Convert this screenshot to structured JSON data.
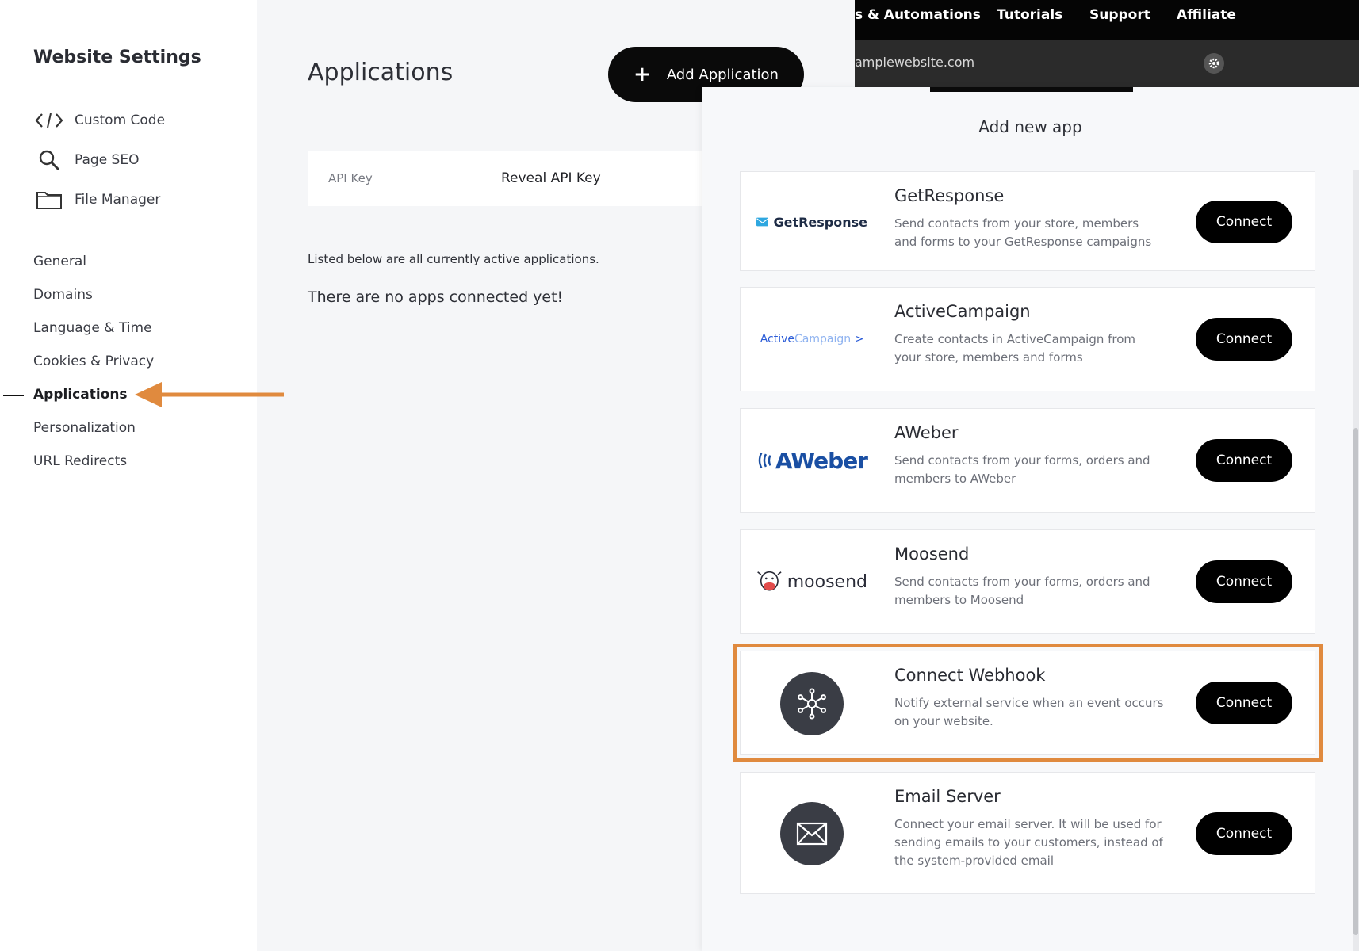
{
  "sidebar": {
    "title": "Website Settings",
    "tools": [
      {
        "label": "Custom Code",
        "icon": "code-icon"
      },
      {
        "label": "Page SEO",
        "icon": "search-icon"
      },
      {
        "label": "File Manager",
        "icon": "folder-icon"
      }
    ],
    "nav": [
      {
        "label": "General"
      },
      {
        "label": "Domains"
      },
      {
        "label": "Language & Time"
      },
      {
        "label": "Cookies & Privacy"
      },
      {
        "label": "Applications",
        "active": true
      },
      {
        "label": "Personalization"
      },
      {
        "label": "URL Redirects"
      }
    ]
  },
  "main": {
    "title": "Applications",
    "add_button": "Add Application",
    "api_key_label": "API Key",
    "api_key_reveal": "Reveal API Key",
    "listed_text": "Listed below are all currently active applications.",
    "empty_text": "There are no apps connected yet!"
  },
  "topbar": {
    "items": [
      "s & Automations",
      "Tutorials",
      "Support",
      "Affiliate"
    ],
    "url": "amplewebsite.com"
  },
  "panel": {
    "title": "Add new app",
    "apps": [
      {
        "name": "GetResponse",
        "logo_text": "GetResponse",
        "description": "Send contacts from your store, members and forms to your GetResponse campaigns",
        "button": "Connect"
      },
      {
        "name": "ActiveCampaign",
        "logo_text_a": "Active",
        "logo_text_b": "Campaign",
        "logo_arrow": ">",
        "description": "Create contacts in ActiveCampaign from your store, members and forms",
        "button": "Connect"
      },
      {
        "name": "AWeber",
        "logo_text": "AWeber",
        "description": "Send contacts from your forms, orders and members to AWeber",
        "button": "Connect"
      },
      {
        "name": "Moosend",
        "logo_text": "moosend",
        "description": "Send contacts from your forms, orders and members to Moosend",
        "button": "Connect"
      },
      {
        "name": "Connect Webhook",
        "description": "Notify external service when an event occurs on your website.",
        "button": "Connect",
        "highlighted": true
      },
      {
        "name": "Email Server",
        "description": "Connect your email server. It will be used for sending emails to your customers, instead of the system-provided email",
        "button": "Connect"
      }
    ]
  },
  "colors": {
    "accent": "#e08a3e",
    "button": "#000000",
    "icon_circle": "#3a3d45"
  }
}
